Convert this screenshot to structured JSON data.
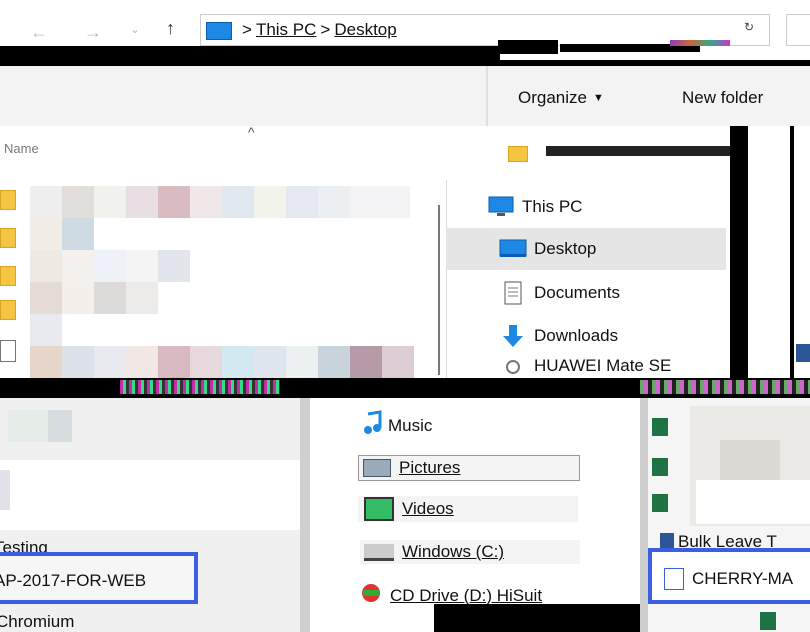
{
  "address": {
    "crumb_1": "This PC",
    "crumb_2": "Desktop",
    "sep": ">"
  },
  "toolbar": {
    "organize_label": "Organize",
    "new_folder_label": "New folder"
  },
  "left_panel": {
    "column_header": "Name"
  },
  "nav_pane": {
    "items": [
      {
        "label": "This PC",
        "icon": "monitor-icon"
      },
      {
        "label": "Desktop",
        "icon": "desktop-icon"
      },
      {
        "label": "Documents",
        "icon": "documents-icon"
      },
      {
        "label": "Downloads",
        "icon": "download-arrow-icon"
      },
      {
        "label": "HUAWEI Mate SE",
        "icon": "phone-icon"
      }
    ]
  },
  "nav_pane_2": {
    "items": [
      {
        "label": "Music",
        "icon": "music-icon"
      },
      {
        "label": "Pictures",
        "icon": "pictures-icon"
      },
      {
        "label": "Videos",
        "icon": "videos-icon"
      },
      {
        "label": "Windows (C:)",
        "icon": "drive-icon"
      },
      {
        "label": "CD Drive (D:) HiSuit",
        "icon": "cd-drive-icon"
      }
    ]
  },
  "left_bottom": {
    "items": [
      "Testing",
      "AP-2017-FOR-WEB",
      "Chromium"
    ]
  },
  "right_bottom": {
    "items": [
      "Bulk Leave T",
      "CHERRY-MA"
    ]
  },
  "colors": {
    "selected_bg": "#cce8ff",
    "hover_bg": "#e5e5e5",
    "accent_blue": "#3c5ee0",
    "icon_blue": "#1e88e5"
  }
}
